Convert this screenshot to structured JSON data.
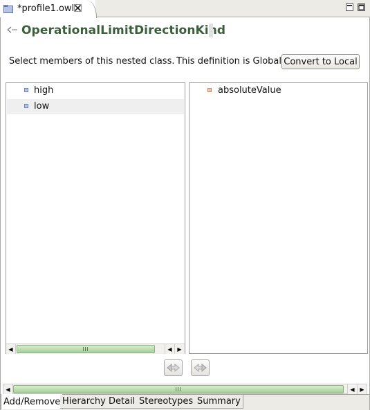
{
  "editor_tab": {
    "label": "*profile1.owl"
  },
  "header": {
    "title": "OperationalLimitDirectionKind"
  },
  "instruction": "Select members of this nested class.",
  "scope_text": "This definition is Global",
  "convert_button": "Convert to Local",
  "left_list": [
    {
      "label": "high",
      "selected": false
    },
    {
      "label": "low",
      "selected": true
    }
  ],
  "right_list": [
    {
      "label": "absoluteValue"
    }
  ],
  "page_tabs": [
    {
      "label": "Add/Remove",
      "active": true
    },
    {
      "label": "Hierarchy",
      "active": false
    },
    {
      "label": "Detail",
      "active": false
    },
    {
      "label": "Stereotypes",
      "active": false
    },
    {
      "label": "Summary",
      "active": false
    }
  ],
  "colors": {
    "title": "#3b5e3b",
    "scroll_thumb": "#a7cf99",
    "member_bullet": "#b9c5e8",
    "attribute_bullet": "#f4c3a7"
  }
}
